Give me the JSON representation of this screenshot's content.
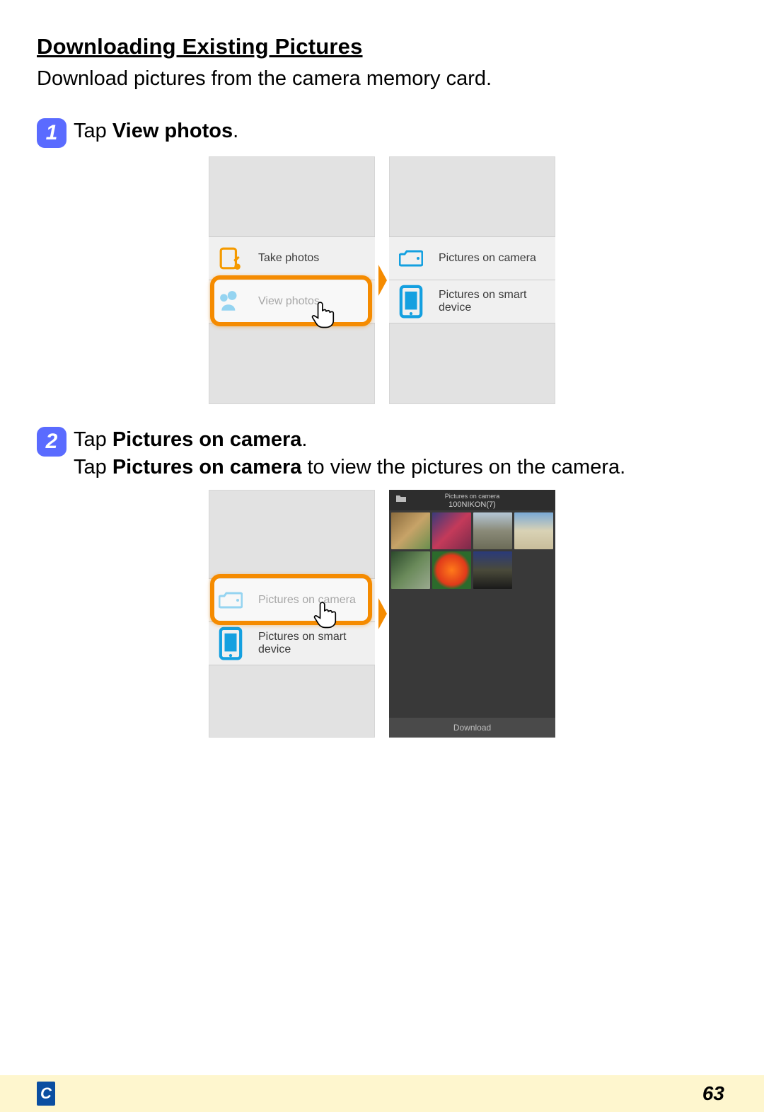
{
  "title": "Downloading Existing Pictures",
  "intro": "Download pictures from the camera memory card.",
  "step1": {
    "num": "1",
    "title_pre": "Tap ",
    "title_bold": "View photos",
    "title_post": ".",
    "left": {
      "items": [
        "Take photos",
        "View photos"
      ]
    },
    "right": {
      "items": [
        "Pictures on camera",
        "Pictures on smart device"
      ]
    }
  },
  "step2": {
    "num": "2",
    "title_pre": "Tap ",
    "title_bold": "Pictures on camera",
    "title_post": ".",
    "sub_pre": "Tap ",
    "sub_bold": "Pictures on camera",
    "sub_post": " to view the pictures on the camera.",
    "left": {
      "items": [
        "Pictures on camera",
        "Pictures on smart device"
      ]
    },
    "gallery": {
      "header_top": "Pictures on camera",
      "header_sub": "100NIKON(7)",
      "footer": "Download"
    }
  },
  "footer": {
    "tab": "C",
    "page": "63"
  }
}
